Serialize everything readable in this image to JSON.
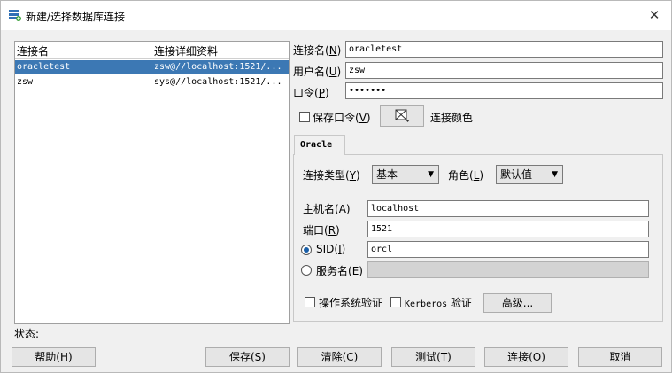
{
  "window": {
    "title": "新建/选择数据库连接",
    "close_glyph": "✕"
  },
  "list": {
    "headers": [
      "连接名",
      "连接详细资料"
    ],
    "rows": [
      {
        "name": "oracletest",
        "details": "zsw@//localhost:1521/...",
        "selected": true
      },
      {
        "name": "zsw",
        "details": "sys@//localhost:1521/...",
        "selected": false
      }
    ]
  },
  "form": {
    "conn_name_label": "连接名(",
    "conn_name_key": "N",
    "conn_name_value": "oracletest",
    "user_label": "用户名(",
    "user_key": "U",
    "user_value": "zsw",
    "password_label": "口令(",
    "password_key": "P",
    "password_value": "•••••••",
    "save_password_label": "保存口令(",
    "save_password_key": "V",
    "save_password_checked": false,
    "connection_color_label": "连接颜色",
    "close_paren": ")"
  },
  "tab": {
    "label": "Oracle"
  },
  "oracle": {
    "conn_type_label": "连接类型(",
    "conn_type_key": "Y",
    "conn_type_value": "基本",
    "role_label": "角色(",
    "role_key": "L",
    "role_value": "默认值",
    "host_label": "主机名(",
    "host_key": "A",
    "host_value": "localhost",
    "port_label": "端口(",
    "port_key": "R",
    "port_value": "1521",
    "sid_label": "SID(",
    "sid_key": "I",
    "sid_value": "orcl",
    "sid_selected": true,
    "service_label": "服务名(",
    "service_key": "E",
    "service_value": "",
    "os_auth_label": "操作系统验证",
    "kerberos_label": "Kerberos",
    "kerberos_suffix": " 验证",
    "advanced_label": "高级..."
  },
  "status": {
    "label": "状态:"
  },
  "buttons": {
    "help": "帮助(H)",
    "save": "保存(S)",
    "clear": "清除(C)",
    "test": "测试(T)",
    "connect": "连接(O)",
    "cancel": "取消"
  },
  "icons": {
    "title": "database-connection-icon",
    "color_picker": "color-picker-icon"
  }
}
